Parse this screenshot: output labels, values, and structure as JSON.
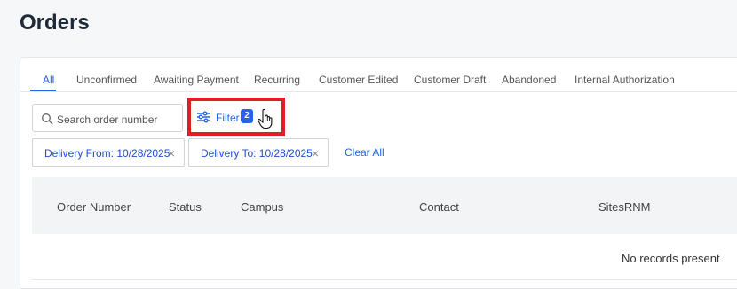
{
  "page": {
    "title": "Orders"
  },
  "tabs": [
    {
      "label": "All",
      "active": true
    },
    {
      "label": "Unconfirmed"
    },
    {
      "label": "Awaiting Payment"
    },
    {
      "label": "Recurring"
    },
    {
      "label": "Customer Edited"
    },
    {
      "label": "Customer Draft"
    },
    {
      "label": "Abandoned"
    },
    {
      "label": "Internal Authorization"
    }
  ],
  "search": {
    "placeholder": "Search order number",
    "value": ""
  },
  "filter": {
    "label": "Filter",
    "count": "2"
  },
  "chips": [
    {
      "label": "Delivery From: 10/28/2025",
      "remove": "×"
    },
    {
      "label": "Delivery To: 10/28/2025",
      "remove": "×"
    }
  ],
  "clear_all": "Clear All",
  "table": {
    "columns": [
      "Order Number",
      "Status",
      "Campus",
      "Contact",
      "SitesRNM"
    ],
    "empty_message": "No records present"
  },
  "colors": {
    "accent": "#2563eb",
    "highlight": "#e11d2a"
  }
}
